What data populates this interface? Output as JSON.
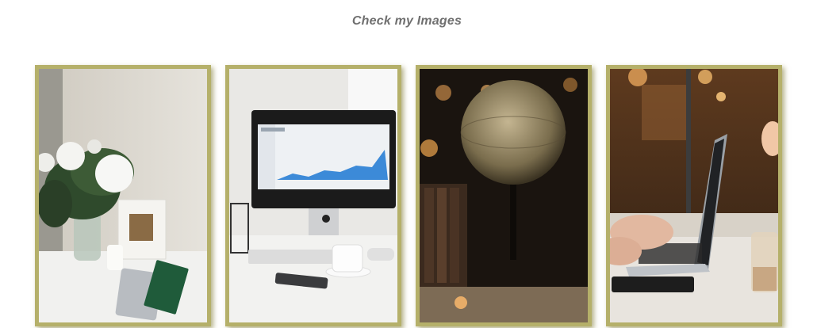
{
  "heading": "Check my Images",
  "colors": {
    "frame": "#b5b06a",
    "heading_text": "#707070",
    "background": "#ffffff"
  },
  "gallery": {
    "images": [
      {
        "name": "flowers-desk-photo"
      },
      {
        "name": "imac-desk-photo"
      },
      {
        "name": "globe-photo"
      },
      {
        "name": "laptop-cafe-photo"
      }
    ]
  }
}
